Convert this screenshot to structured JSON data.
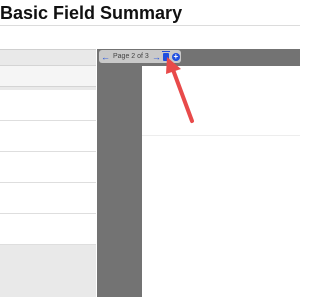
{
  "header": {
    "title": "Basic Field Summary"
  },
  "viewer": {
    "toolbar": {
      "prev_icon": "arrow-left-icon",
      "page_label": "Page 2 of 3",
      "next_icon": "arrow-right-icon",
      "delete_icon": "trash-icon",
      "add_icon": "plus-circle-icon"
    }
  },
  "colors": {
    "toolbar_icon": "#1f4fe0",
    "annotation_arrow": "#e84a4a",
    "viewer_background": "#737373"
  }
}
